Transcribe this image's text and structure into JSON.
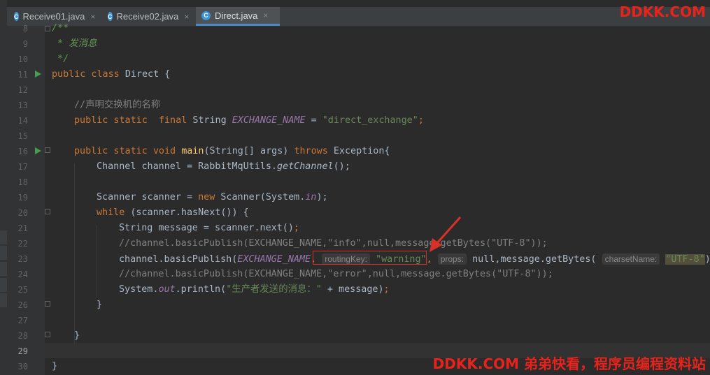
{
  "tabs": [
    {
      "label": "Receive01.java",
      "active": false
    },
    {
      "label": "Receive02.java",
      "active": false
    },
    {
      "label": "Direct.java",
      "active": true
    }
  ],
  "file_icon_letter": "C",
  "close_glyph": "×",
  "line_numbers": [
    "8",
    "9",
    "10",
    "11",
    "12",
    "13",
    "14",
    "15",
    "16",
    "17",
    "18",
    "19",
    "20",
    "21",
    "22",
    "23",
    "24",
    "25",
    "26",
    "27",
    "28",
    "29",
    "30"
  ],
  "current_line": "29",
  "code": {
    "l8": "/**",
    "l9": " * 发消息",
    "l10": " */",
    "l11_a": "public class ",
    "l11_b": "Direct {",
    "l13": "//声明交换机的名称",
    "l14_kw": "public static  final ",
    "l14_type": "String ",
    "l14_var": "EXCHANGE_NAME",
    "l14_eq": " = ",
    "l14_str": "\"direct_exchange\"",
    "l14_end": ";",
    "l16_kw": "public static void ",
    "l16_fn": "main",
    "l16_args": "(String[] args) ",
    "l16_throws": "throws ",
    "l16_exc": "Exception{",
    "l17_a": "Channel channel = RabbitMqUtils.",
    "l17_b": "getChannel",
    "l17_c": "();",
    "l19_a": "Scanner scanner = ",
    "l19_new": "new ",
    "l19_b": "Scanner(System.",
    "l19_in": "in",
    "l19_c": ");",
    "l20_kw": "while ",
    "l20_b": "(scanner.hasNext()) {",
    "l21_a": "String message = scanner.next()",
    "l21_b": ";",
    "l22": "//channel.basicPublish(EXCHANGE_NAME,\"info\",null,message.getBytes(\"UTF-8\"));",
    "l23_a": "channel.basicPublish(",
    "l23_var": "EXCHANGE_NAME",
    "l23_comma": ",",
    "l23_hint1": "routingKey:",
    "l23_str": "\"warning\"",
    "l23_comma2": ",",
    "l23_hint2": "props:",
    "l23_b": "null,message.getBytes(",
    "l23_hint3": "charsetName:",
    "l23_str2": "\"UTF-8\"",
    "l23_c": "));",
    "l24": "//channel.basicPublish(EXCHANGE_NAME,\"error\",null,message.getBytes(\"UTF-8\"));",
    "l25_a": "System.",
    "l25_out": "out",
    "l25_b": ".println(",
    "l25_str": "\"生产者发送的消息：\"",
    "l25_c": " + message)",
    "l25_d": ";",
    "l26": "}",
    "l28": "}",
    "l30": "}"
  },
  "watermark_top": "DDKK.COM",
  "watermark_bottom": "DDKK.COM 弟弟快看，程序员编程资料站",
  "colors": {
    "keyword": "#cc7832",
    "string": "#6a8759",
    "comment": "#808080",
    "field": "#9876aa",
    "annotation_red": "#d9302a"
  }
}
